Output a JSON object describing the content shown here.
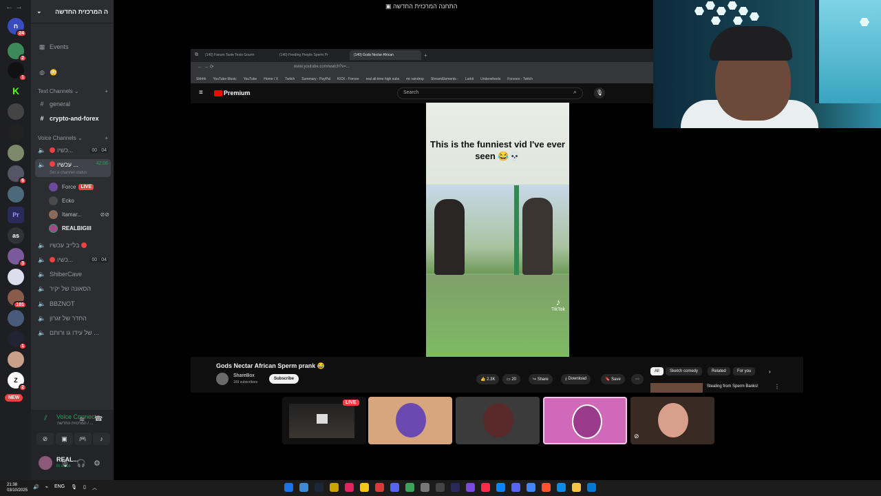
{
  "discord": {
    "server_name": "ה המרכזית החדשה",
    "rail_badges": [
      "24",
      "2",
      "1",
      "6",
      "3",
      "101",
      "1",
      "2"
    ],
    "rail_labels": [
      "Pr",
      "as",
      "NEW"
    ],
    "events_label": "Events",
    "emoji_row": "😳",
    "text_category": "Text Channels",
    "text_channels": [
      "general",
      "crypto-and-forex"
    ],
    "voice_category": "Voice Channels",
    "voice_channels": [
      {
        "name": "כשיו...",
        "count_a": "00",
        "count_b": "04"
      },
      {
        "name": "עכשיו ...",
        "time": "42:06",
        "status": "Set a channel status"
      },
      {
        "name": "בלייב עכשיו"
      },
      {
        "name": "כשיו...",
        "count_a": "00",
        "count_b": "04"
      },
      {
        "name": "ShiberCave"
      },
      {
        "name": "הסאונה של יקיר"
      },
      {
        "name": "BBZNOT"
      },
      {
        "name": "החדר של זגרון"
      },
      {
        "name": "של עידו גו ורותם ..."
      }
    ],
    "members": [
      {
        "name": "Force",
        "live": "LIVE"
      },
      {
        "name": "Ecko"
      },
      {
        "name": "Itamar..."
      },
      {
        "name": "REALBIGIII"
      }
    ],
    "voice_panel": {
      "title": "Voice Connecte",
      "subtitle": "המרכזית החדשה / ...",
      "user": "REAL...",
      "user_status": "In voice"
    }
  },
  "stream": {
    "window_title": "התחנה המרכזית החדשה",
    "tabs": [
      "(140) Fanum Taste Tests Gourm",
      "(140) Feeding People Sperm Pr",
      "(140) Gods Nectar African"
    ],
    "url": "www.youtube.com/watch?v=...",
    "bookmarks": [
      "Shhhh",
      "YouTube Music",
      "YouTube",
      "Home / X",
      "Twitch",
      "Summary - PayPal",
      "KICK - Forcee",
      "real all-time high subs",
      "mr raindrop",
      "StreamElements -",
      "Lurkit",
      "Underwheels",
      "Forceex - Twitch"
    ],
    "yt_logo": "Premium",
    "search_placeholder": "Search",
    "video_caption": "This is the funniest vid I've ever seen 😂💀",
    "tiktok_label": "TikTok",
    "video_title": "Gods Nectar African Sperm prank 😂",
    "channel": "ShareBox",
    "subscribers": "169 subscribers",
    "subscribe": "Subscribe",
    "likes": "2.3K",
    "comments": "20",
    "share": "Share",
    "download": "Download",
    "save": "Save",
    "chips": [
      "All",
      "Sketch comedy",
      "Related",
      "For you"
    ],
    "recommended": "Stealing from Sperm Banks!"
  },
  "participants": {
    "live_label": "LIVE"
  },
  "taskbar": {
    "time": "21:38",
    "date": "03/10/2025",
    "lang": "ENG"
  }
}
